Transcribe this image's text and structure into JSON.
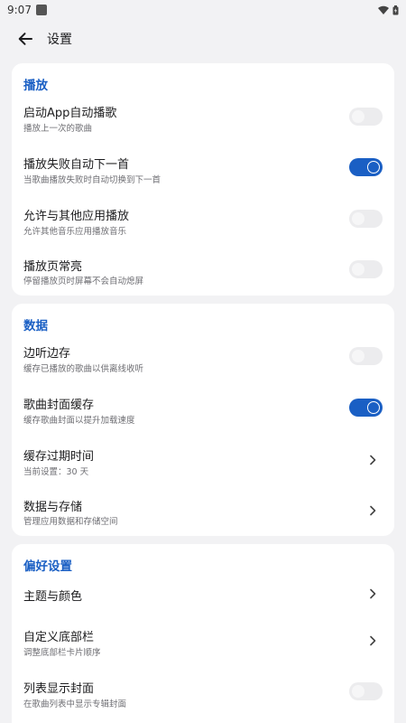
{
  "status": {
    "time": "9:07"
  },
  "header": {
    "title": "设置"
  },
  "sections": [
    {
      "title": "播放",
      "rows": [
        {
          "title": "启动App自动播歌",
          "subtitle": "播放上一次的歌曲",
          "control": "toggle",
          "checked": false
        },
        {
          "title": "播放失败自动下一首",
          "subtitle": "当歌曲播放失败时自动切换到下一首",
          "control": "toggle",
          "checked": true
        },
        {
          "title": "允许与其他应用播放",
          "subtitle": "允许其他音乐应用播放音乐",
          "control": "toggle",
          "checked": false
        },
        {
          "title": "播放页常亮",
          "subtitle": "停留播放页时屏幕不会自动熄屏",
          "control": "toggle",
          "checked": false
        }
      ]
    },
    {
      "title": "数据",
      "rows": [
        {
          "title": "边听边存",
          "subtitle": "缓存已播放的歌曲以供离线收听",
          "control": "toggle",
          "checked": false
        },
        {
          "title": "歌曲封面缓存",
          "subtitle": "缓存歌曲封面以提升加载速度",
          "control": "toggle",
          "checked": true
        },
        {
          "title": "缓存过期时间",
          "subtitle": "当前设置：30 天",
          "control": "chevron"
        },
        {
          "title": "数据与存储",
          "subtitle": "管理应用数据和存储空间",
          "control": "chevron"
        }
      ]
    },
    {
      "title": "偏好设置",
      "rows": [
        {
          "title": "主题与颜色",
          "subtitle": "",
          "control": "chevron"
        },
        {
          "title": "自定义底部栏",
          "subtitle": "调整底部栏卡片顺序",
          "control": "chevron"
        },
        {
          "title": "列表显示封面",
          "subtitle": "在歌曲列表中显示专辑封面",
          "control": "toggle",
          "checked": false
        }
      ]
    }
  ],
  "colors": {
    "accent": "#1a5fc4",
    "background": "#f2f2f4",
    "card": "#ffffff"
  }
}
